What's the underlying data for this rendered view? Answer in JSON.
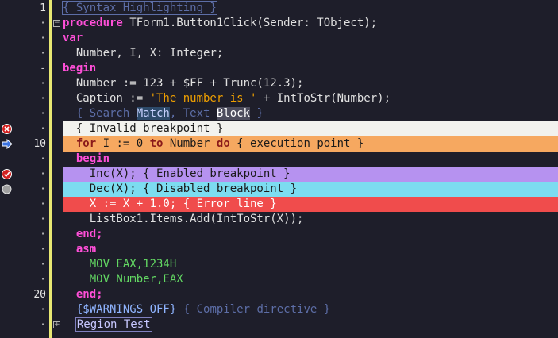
{
  "gutter": {
    "line_labels": [
      "1",
      "·",
      "·",
      "·",
      "-",
      "·",
      "·",
      "·",
      "·",
      "10",
      "·",
      "·",
      "·",
      "·",
      "·",
      "·",
      "·",
      "·",
      "·",
      "20",
      "·",
      "·"
    ]
  },
  "code_lines": [
    {
      "segments": [
        {
          "t": "{ Syntax Highlighting }",
          "c": "cm syntax-box"
        }
      ]
    },
    {
      "segments": [
        {
          "t": "procedure",
          "c": "kw"
        },
        {
          "t": " TForm1.Button1Click(Sender: TObject);",
          "c": ""
        }
      ]
    },
    {
      "segments": [
        {
          "t": "var",
          "c": "kw"
        }
      ]
    },
    {
      "segments": [
        {
          "t": "  Number, I, X: Integer;",
          "c": ""
        }
      ]
    },
    {
      "segments": [
        {
          "t": "begin",
          "c": "kw"
        }
      ]
    },
    {
      "segments": [
        {
          "t": "  Number := 123 + $FF + Trunc(12.3);",
          "c": ""
        }
      ]
    },
    {
      "segments": [
        {
          "t": "  Caption := ",
          "c": ""
        },
        {
          "t": "'The number is '",
          "c": "str"
        },
        {
          "t": " + IntToStr(Number);",
          "c": ""
        }
      ]
    },
    {
      "segments": [
        {
          "t": "  { Search ",
          "c": "cm"
        },
        {
          "t": "Match",
          "c": "match"
        },
        {
          "t": ", Text ",
          "c": "cm"
        },
        {
          "t": "Block",
          "c": "block"
        },
        {
          "t": " }",
          "c": "cm"
        }
      ]
    },
    {
      "hl": "hl-invalid",
      "segments": [
        {
          "t": "  { Invalid breakpoint }",
          "c": ""
        }
      ]
    },
    {
      "hl": "hl-exec",
      "segments": [
        {
          "t": "  ",
          "c": ""
        },
        {
          "t": "for",
          "c": "kw2"
        },
        {
          "t": " I := 0 ",
          "c": ""
        },
        {
          "t": "to",
          "c": "kw2"
        },
        {
          "t": " Number ",
          "c": ""
        },
        {
          "t": "do",
          "c": "kw2"
        },
        {
          "t": " { execution point }",
          "c": ""
        }
      ]
    },
    {
      "segments": [
        {
          "t": "  begin",
          "c": "kw"
        }
      ]
    },
    {
      "hl": "hl-enabled",
      "segments": [
        {
          "t": "    Inc(X); { Enabled breakpoint }",
          "c": ""
        }
      ]
    },
    {
      "hl": "hl-disabled",
      "segments": [
        {
          "t": "    Dec(X); { Disabled breakpoint }",
          "c": ""
        }
      ]
    },
    {
      "hl": "hl-error",
      "segments": [
        {
          "t": "    X := X + 1.0; { Error line }",
          "c": ""
        }
      ]
    },
    {
      "segments": [
        {
          "t": "    ListBox1.Items.Add(IntToStr(X));",
          "c": ""
        }
      ]
    },
    {
      "segments": [
        {
          "t": "  end;",
          "c": "kw"
        }
      ]
    },
    {
      "segments": [
        {
          "t": "  asm",
          "c": "kw"
        }
      ]
    },
    {
      "segments": [
        {
          "t": "    MOV EAX,1234H",
          "c": "asm"
        }
      ]
    },
    {
      "segments": [
        {
          "t": "    MOV Number,EAX",
          "c": "asm"
        }
      ]
    },
    {
      "segments": [
        {
          "t": "  end;",
          "c": "kw"
        }
      ]
    },
    {
      "segments": [
        {
          "t": "  ",
          "c": ""
        },
        {
          "t": "{$WARNINGS OFF}",
          "c": "dir"
        },
        {
          "t": " { Compiler directive }",
          "c": "cm"
        }
      ]
    },
    {
      "segments": [
        {
          "t": "  ",
          "c": ""
        },
        {
          "t": "Region Test",
          "c": "region-box"
        }
      ]
    }
  ],
  "colors": {
    "background": "#1e1e2a",
    "keyword": "#ff4fd8",
    "comment": "#5d6ea7",
    "string": "#f0a000",
    "asm": "#63d963",
    "change_bar": "#e8e873",
    "invalid_breakpoint": "#f2f2ee",
    "execution_point": "#f6a860",
    "enabled_breakpoint": "#b692f0",
    "disabled_breakpoint": "#7cdcf0",
    "error_line": "#f04c4c"
  },
  "gutter_icons": [
    {
      "row": 8,
      "name": "invalid-breakpoint-icon"
    },
    {
      "row": 9,
      "name": "execution-point-arrow-icon"
    },
    {
      "row": 11,
      "name": "enabled-breakpoint-icon"
    },
    {
      "row": 12,
      "name": "disabled-breakpoint-icon"
    }
  ],
  "fold_markers": [
    {
      "row": 1,
      "symbol": "−",
      "name": "fold-collapse-icon"
    },
    {
      "row": 21,
      "symbol": "+",
      "name": "fold-expand-icon"
    }
  ]
}
